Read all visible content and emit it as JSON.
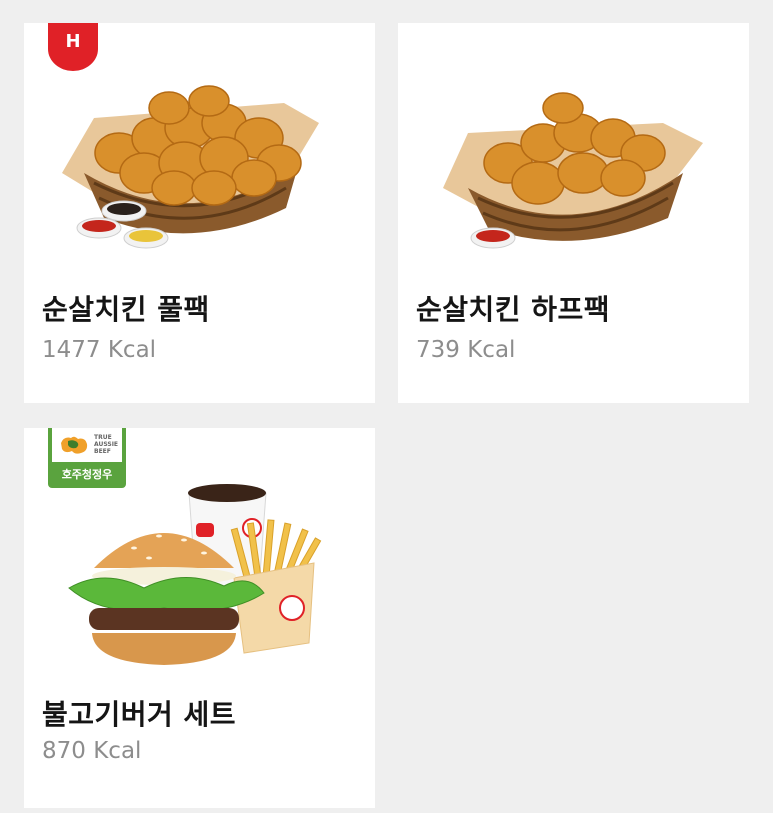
{
  "menu": {
    "items": [
      {
        "name": "순살치킨 풀팩",
        "kcal": "1477 Kcal",
        "badge": "H"
      },
      {
        "name": "순살치킨 하프팩",
        "kcal": "739 Kcal"
      },
      {
        "name": "불고기버거 세트",
        "kcal": "870 Kcal",
        "badge_label": "호주청정우",
        "badge_logo_text": "TRUE AUSSIE BEEF"
      }
    ]
  },
  "colors": {
    "background": "#efefef",
    "card": "#ffffff",
    "accent_red": "#e02127",
    "badge_green": "#5aa33e",
    "title": "#151515",
    "kcal": "#8d8d8d"
  },
  "icons": [
    "h-badge-icon",
    "true-aussie-beef-logo"
  ]
}
